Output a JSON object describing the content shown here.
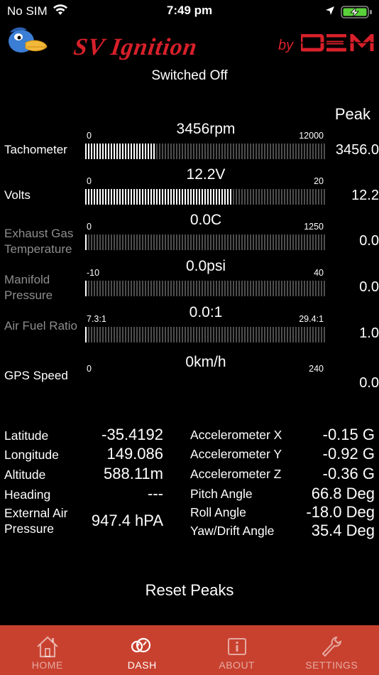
{
  "status": {
    "carrier": "No SIM",
    "time": "7:49 pm"
  },
  "header": {
    "brand": "SV Ignition",
    "by": "by",
    "maker": "OEM"
  },
  "ignition_state": "Switched Off",
  "peak_header": "Peak",
  "gauges": [
    {
      "label": "Tachometer",
      "min": "0",
      "max": "12000",
      "value": "3456rpm",
      "peak": "3456.0",
      "fill": 0.288,
      "dim": false
    },
    {
      "label": "Volts",
      "min": "0",
      "max": "20",
      "value": "12.2V",
      "peak": "12.2",
      "fill": 0.61,
      "dim": false
    },
    {
      "label": "Exhaust Gas Temperature",
      "min": "0",
      "max": "1250",
      "value": "0.0C",
      "peak": "0.0",
      "fill": 0,
      "dim": true
    },
    {
      "label": "Manifold Pressure",
      "min": "-10",
      "max": "40",
      "value": "0.0psi",
      "peak": "0.0",
      "fill": 0,
      "dim": true
    },
    {
      "label": "Air Fuel Ratio",
      "min": "7.3:1",
      "max": "29.4:1",
      "value": "0.0:1",
      "peak": "1.0",
      "fill": 0,
      "dim": true
    },
    {
      "label": "GPS Speed",
      "min": "0",
      "max": "240",
      "value": "0km/h",
      "peak": "0.0",
      "fill": null,
      "dim": false
    }
  ],
  "left_info": [
    {
      "label": "Latitude",
      "value": "-35.4192"
    },
    {
      "label": "Longitude",
      "value": "149.086"
    },
    {
      "label": "Altitude",
      "value": "588.11m"
    },
    {
      "label": "Heading",
      "value": "---"
    },
    {
      "label": "External Air Pressure",
      "value": "947.4 hPA"
    }
  ],
  "right_info": [
    {
      "label": "Accelerometer X",
      "value": "-0.15 G"
    },
    {
      "label": "Accelerometer Y",
      "value": "-0.92 G"
    },
    {
      "label": "Accelerometer Z",
      "value": "-0.36 G"
    },
    {
      "label": "Pitch Angle",
      "value": "66.8 Deg"
    },
    {
      "label": "Roll Angle",
      "value": "-18.0 Deg"
    },
    {
      "label": "Yaw/Drift Angle",
      "value": "35.4 Deg"
    }
  ],
  "reset_label": "Reset Peaks",
  "tabs": [
    {
      "label": "HOME",
      "icon": "home-icon",
      "active": false
    },
    {
      "label": "DASH",
      "icon": "dash-icon",
      "active": true
    },
    {
      "label": "ABOUT",
      "icon": "info-icon",
      "active": false
    },
    {
      "label": "SETTINGS",
      "icon": "wrench-icon",
      "active": false
    }
  ],
  "colors": {
    "accent": "#d8202a",
    "tabbar": "#c8412f",
    "dim_text": "#8d8d8d"
  }
}
